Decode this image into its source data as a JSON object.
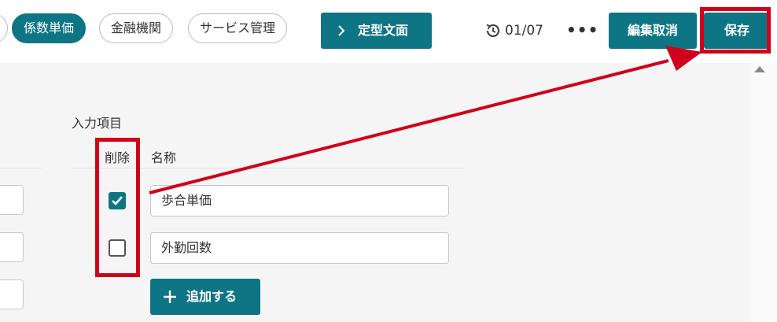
{
  "toolbar": {
    "chips": [
      {
        "label": "係数単価",
        "active": true
      },
      {
        "label": "金融機関",
        "active": false
      },
      {
        "label": "サービス管理",
        "active": false
      }
    ],
    "template_button_label": "定型文面",
    "history_counter": "01/07",
    "cancel_edit_label": "編集取消",
    "save_label": "保存"
  },
  "form": {
    "section_title": "入力項目",
    "columns": {
      "delete": "削除",
      "name": "名称"
    },
    "rows": [
      {
        "name": "歩合単価",
        "delete_checked": true
      },
      {
        "name": "外勤回数",
        "delete_checked": false
      }
    ],
    "add_button_label": "追加する"
  },
  "colors": {
    "accent": "#0e7585",
    "highlight": "#d0021b"
  },
  "icons": [
    "chevron-right-icon",
    "history-icon",
    "more-icon",
    "check-icon",
    "plus-icon",
    "scroll-up-icon"
  ]
}
